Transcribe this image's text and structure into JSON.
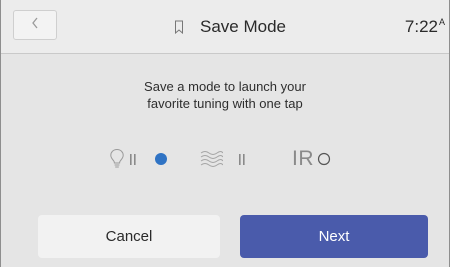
{
  "header": {
    "back_glyph": "<",
    "title": "Save Mode",
    "clock_time": "7:22",
    "clock_suffix": "A"
  },
  "instruction": {
    "line1": "Save a mode to launch your",
    "line2": "favorite tuning with one tap"
  },
  "mode_icons": [
    {
      "icon": "lightbulb-icon",
      "state": "paused"
    },
    {
      "icon": "radio-dot-icon",
      "state": "selected",
      "color": "#2f73c4"
    },
    {
      "icon": "waves-icon",
      "state": "paused"
    },
    {
      "icon": "ir-icon",
      "label": "IR",
      "state": "unselected"
    }
  ],
  "ir_label": "IR",
  "actions": {
    "cancel_label": "Cancel",
    "next_label": "Next"
  },
  "colors": {
    "accent": "#4a5bab",
    "selected_dot": "#2f73c4",
    "background": "#e5e5e5"
  }
}
